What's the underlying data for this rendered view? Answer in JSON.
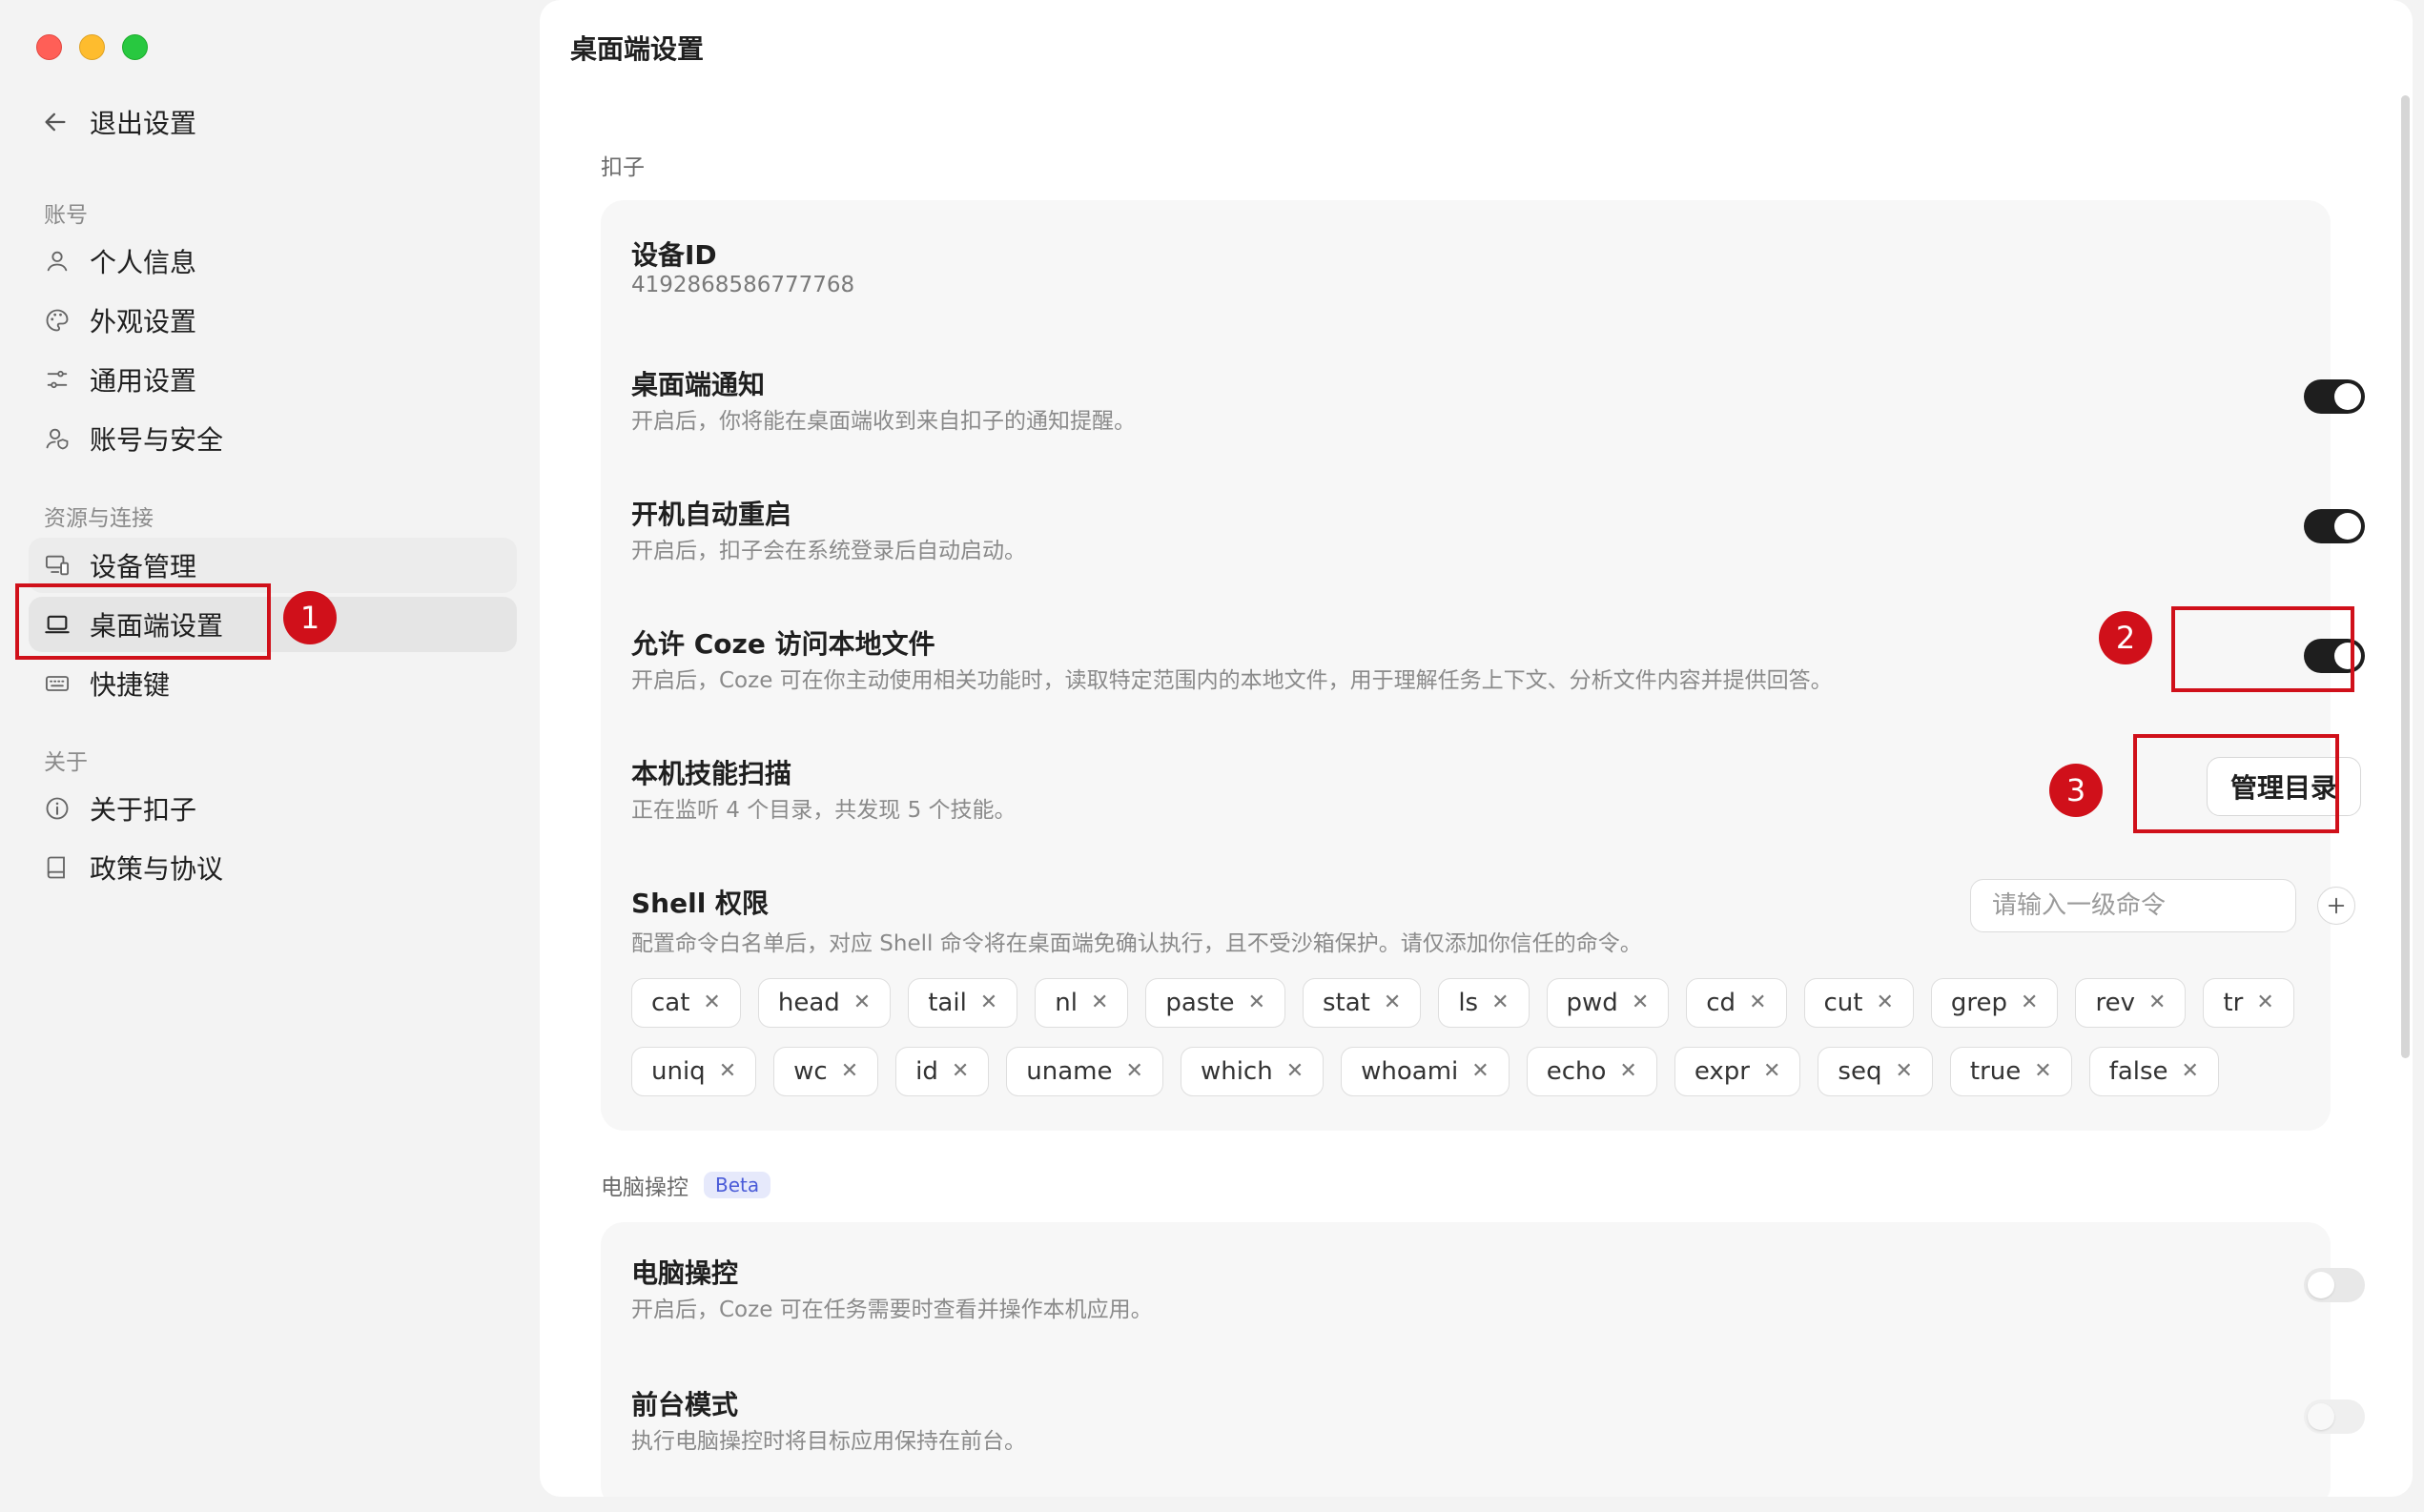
{
  "sidebar": {
    "back_label": "退出设置",
    "groups": {
      "account": "账号",
      "resources": "资源与连接",
      "about": "关于"
    },
    "items": [
      {
        "label": "个人信息",
        "icon": "person-icon"
      },
      {
        "label": "外观设置",
        "icon": "palette-icon"
      },
      {
        "label": "通用设置",
        "icon": "sliders-icon"
      },
      {
        "label": "账号与安全",
        "icon": "user-shield-icon"
      },
      {
        "label": "设备管理",
        "icon": "devices-icon"
      },
      {
        "label": "桌面端设置",
        "icon": "laptop-icon",
        "active": true
      },
      {
        "label": "快捷键",
        "icon": "keyboard-icon"
      },
      {
        "label": "关于扣子",
        "icon": "info-icon"
      },
      {
        "label": "政策与协议",
        "icon": "book-icon"
      }
    ]
  },
  "main": {
    "title": "桌面端设置",
    "section_koze": "扣子",
    "device": {
      "title": "设备ID",
      "value": "4192868586777768"
    },
    "notify": {
      "title": "桌面端通知",
      "desc": "开启后，你将能在桌面端收到来自扣子的通知提醒。",
      "enabled": true
    },
    "autostart": {
      "title": "开机自动重启",
      "desc": "开启后，扣子会在系统登录后自动启动。",
      "enabled": true
    },
    "local_files": {
      "title": "允许 Coze 访问本地文件",
      "desc": "开启后，Coze 可在你主动使用相关功能时，读取特定范围内的本地文件，用于理解任务上下文、分析文件内容并提供回答。",
      "enabled": true
    },
    "skills": {
      "title": "本机技能扫描",
      "desc": "正在监听 4 个目录，共发现 5 个技能。",
      "button": "管理目录"
    },
    "shell": {
      "title": "Shell 权限",
      "desc": "配置命令白名单后，对应 Shell 命令将在桌面端免确认执行，且不受沙箱保护。请仅添加你信任的命令。",
      "input_placeholder": "请输入一级命令",
      "commands": [
        "cat",
        "head",
        "tail",
        "nl",
        "paste",
        "stat",
        "ls",
        "pwd",
        "cd",
        "cut",
        "grep",
        "rev",
        "tr",
        "uniq",
        "wc",
        "id",
        "uname",
        "which",
        "whoami",
        "echo",
        "expr",
        "seq",
        "true",
        "false"
      ]
    },
    "section_computer": "电脑操控",
    "beta_badge": "Beta",
    "computer_control": {
      "title": "电脑操控",
      "desc": "开启后，Coze 可在任务需要时查看并操作本机应用。",
      "enabled": false
    },
    "foreground": {
      "title": "前台模式",
      "desc": "执行电脑操控时将目标应用保持在前台。",
      "enabled": false
    }
  },
  "annotations": {
    "one": "1",
    "two": "2",
    "three": "3",
    "color": "#d0101a"
  },
  "colors": {
    "toggle_on": "#1e1e1e",
    "sidebar_bg": "#f3f3f3",
    "card_bg": "#f7f7f7",
    "beta": "#4a5bd8"
  }
}
